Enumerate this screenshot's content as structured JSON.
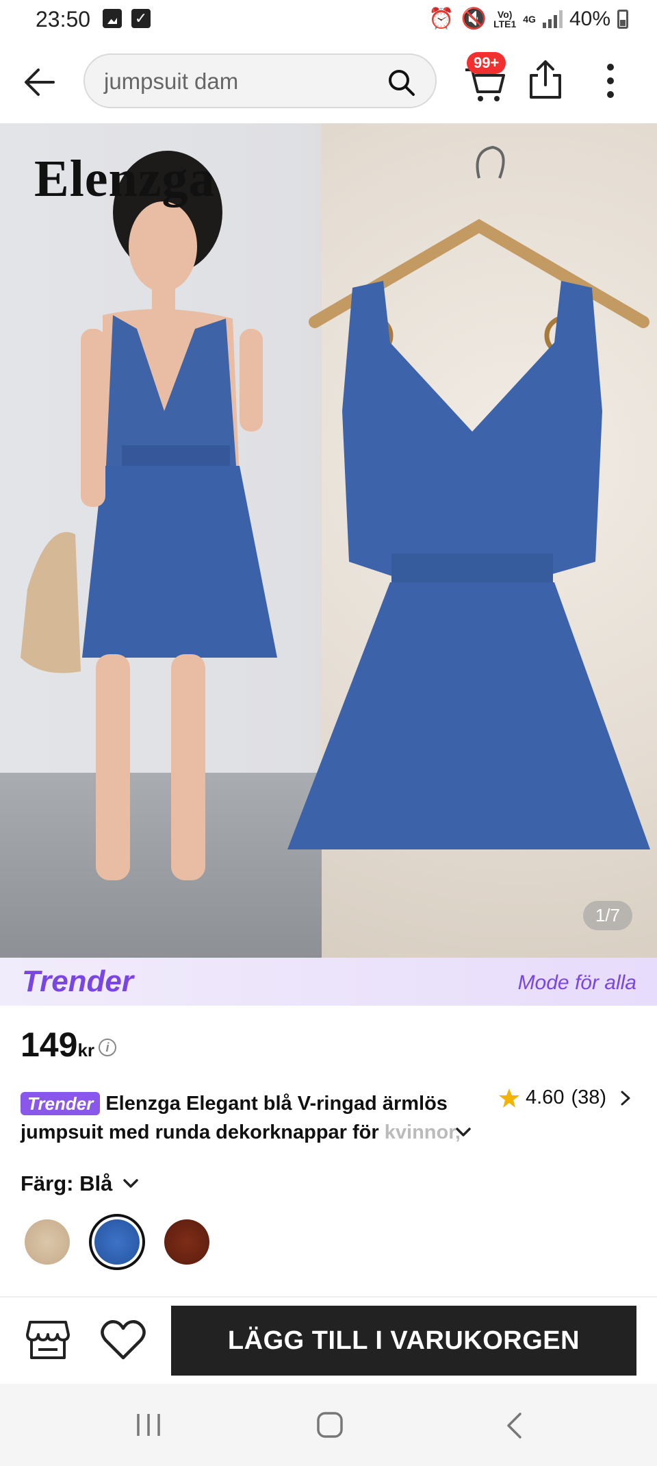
{
  "status_bar": {
    "time": "23:50",
    "network_top": "Vo)",
    "network_bottom": "LTE1",
    "network_type": "4G",
    "battery": "40%"
  },
  "header": {
    "search_query": "jumpsuit dam",
    "cart_badge": "99+"
  },
  "gallery": {
    "brand_watermark": "Elenzga",
    "counter": "1/7"
  },
  "banner": {
    "logo": "Trender",
    "tagline": "Mode för alla"
  },
  "product": {
    "price": "149",
    "currency": "kr",
    "badge": "Trender",
    "title_line1": "Elenzga Elegant blå V-ringad ärmlös",
    "title_line2": "jumpsuit med runda dekorknappar för ",
    "title_fade": "kvinnor,",
    "rating": "4.60",
    "review_count": "(38)",
    "color_label": "Färg: Blå",
    "swatch_colors": [
      "#d3bc9e",
      "#2f63b8",
      "#6e2413"
    ]
  },
  "actions": {
    "add_to_cart": "LÄGG TILL I VARUKORGEN"
  },
  "colors": {
    "accent": "#7a45e5",
    "badge_red": "#f23030",
    "star": "#f2b400"
  }
}
